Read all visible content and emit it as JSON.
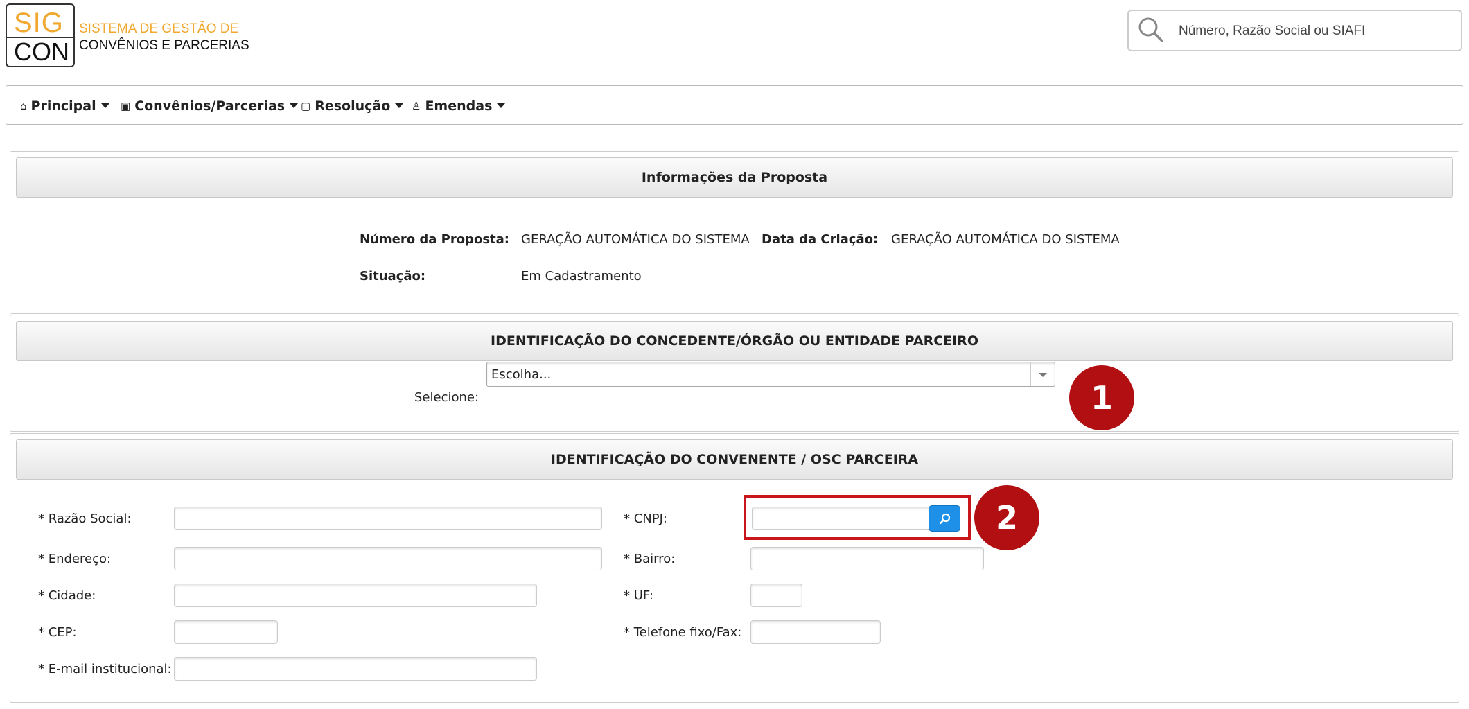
{
  "logo": {
    "top": "SIG",
    "bottom": "CON"
  },
  "brand": {
    "line1": "SISTEMA DE GESTÃO DE",
    "line2": "CONVÊNIOS E PARCERIAS"
  },
  "search": {
    "placeholder": "Número, Razão Social ou SIAFI",
    "icon": "search-icon"
  },
  "nav": [
    {
      "label": "Principal",
      "icon": "home-icon"
    },
    {
      "label": "Convênios/Parcerias",
      "icon": "handshake-icon"
    },
    {
      "label": "Resolução",
      "icon": "document-icon"
    },
    {
      "label": "Emendas",
      "icon": "user-icon"
    }
  ],
  "proposta": {
    "title": "Informações da Proposta",
    "numero_label": "Número da Proposta:",
    "numero_value": "GERAÇÃO AUTOMÁTICA DO SISTEMA",
    "data_label": "Data da Criação:",
    "data_value": "GERAÇÃO AUTOMÁTICA DO SISTEMA",
    "situacao_label": "Situação:",
    "situacao_value": "Em Cadastramento"
  },
  "concedente": {
    "title": "IDENTIFICAÇÃO DO CONCEDENTE/ÓRGÃO OU ENTIDADE PARCEIRO",
    "select_label": "Selecione:",
    "select_value": "Escolha..."
  },
  "convenente": {
    "title": "IDENTIFICAÇÃO DO CONVENENTE / OSC PARCEIRA",
    "razao_social": "* Razão Social:",
    "endereco": "* Endereço:",
    "cidade": "* Cidade:",
    "cep": "* CEP:",
    "email": "* E-mail institucional:",
    "cnpj": "* CNPJ:",
    "bairro": "* Bairro:",
    "uf": "* UF:",
    "telefone": "* Telefone fixo/Fax:"
  },
  "markers": {
    "m1": "1",
    "m2": "2"
  },
  "colors": {
    "accent": "#f0a830",
    "marker": "#b20f12",
    "button": "#1e90e8"
  }
}
